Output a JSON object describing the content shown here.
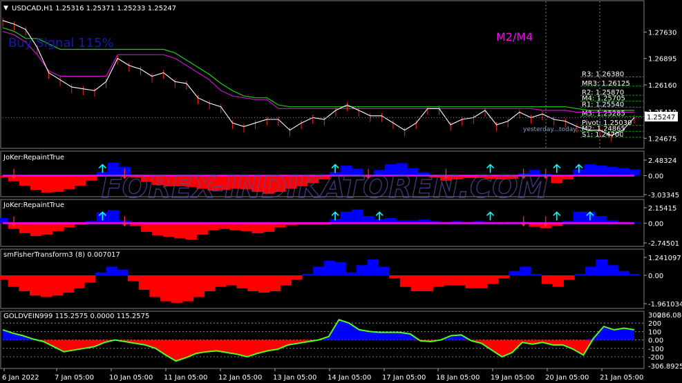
{
  "colors": {
    "background": "#000000",
    "grid": "#4a4a4a",
    "price_line": "#ffffff",
    "wick": "#ff2020",
    "envelope_upper": "#18d018",
    "envelope_lower": "#d010d0",
    "buy_label": "#1a1aaa",
    "m2m4_label": "#ff00ff",
    "histogram_positive": "#0000ff",
    "histogram_negative": "#ff0000",
    "zero_line": "#ff00ff",
    "arrow_up": "#00ffff",
    "arrow_down": "#ff3030",
    "goldvein_line": "#50ff20",
    "pivot_dash": "#00a000",
    "watermark": "#5a4aa0"
  },
  "main_panel": {
    "header": "USDCAD,H1  1.25316 1.25371 1.25233 1.25247",
    "signal_label": "Buy Signal 115%",
    "mode_label": "M2/M4",
    "current_price": "1.25247",
    "yesterday_label": "yesterday...today...",
    "menu_icon": "triangle-down-icon"
  },
  "watermark": "FOREX-INDIKATOREN.COM",
  "chart_data": [
    {
      "type": "line",
      "name": "USDCAD H1 price",
      "ylim": [
        1.2445,
        1.281
      ],
      "y_ticks": [
        "1.27630",
        "1.26895",
        "1.26160",
        "1.25410",
        "1.24675"
      ],
      "x_ticks": [
        "6 Jan 2022",
        "7 Jan 05:00",
        "10 Jan 05:00",
        "11 Jan 05:00",
        "12 Jan 05:00",
        "13 Jan 05:00",
        "14 Jan 05:00",
        "17 Jan 05:00",
        "18 Jan 05:00",
        "19 Jan 05:00",
        "20 Jan 05:00",
        "21 Jan 05:00"
      ],
      "price": [
        1.2795,
        1.2785,
        1.277,
        1.272,
        1.265,
        1.263,
        1.261,
        1.2605,
        1.26,
        1.2625,
        1.269,
        1.267,
        1.266,
        1.264,
        1.265,
        1.2625,
        1.262,
        1.258,
        1.2565,
        1.2555,
        1.251,
        1.25,
        1.251,
        1.252,
        1.252,
        1.249,
        1.251,
        1.2525,
        1.252,
        1.2545,
        1.256,
        1.2545,
        1.253,
        1.253,
        1.251,
        1.249,
        1.251,
        1.255,
        1.255,
        1.2505,
        1.252,
        1.2525,
        1.2545,
        1.2505,
        1.2515,
        1.254,
        1.2525,
        1.2535,
        1.252,
        1.2515,
        1.25,
        1.249,
        1.249,
        1.2475,
        1.249,
        1.2525
      ],
      "envelope_upper": [
        1.2775,
        1.2765,
        1.2745,
        1.2745,
        1.273,
        1.2715,
        1.2715,
        1.2715,
        1.2715,
        1.2715,
        1.2715,
        1.2715,
        1.2715,
        1.2715,
        1.2715,
        1.2705,
        1.2685,
        1.2665,
        1.2645,
        1.262,
        1.26,
        1.2585,
        1.258,
        1.258,
        1.256,
        1.2555,
        1.2555,
        1.2555,
        1.2555,
        1.2555,
        1.2555,
        1.2555,
        1.2555,
        1.2555,
        1.2555,
        1.2555,
        1.2555,
        1.2555,
        1.2555,
        1.2555,
        1.2555,
        1.2555,
        1.2555,
        1.2555,
        1.2555,
        1.2555,
        1.2555,
        1.2555,
        1.2555,
        1.2555,
        1.255,
        1.2545,
        1.2545,
        1.2545,
        1.2545,
        1.2545
      ],
      "envelope_lower": [
        1.2765,
        1.2755,
        1.2735,
        1.27,
        1.2655,
        1.264,
        1.264,
        1.264,
        1.264,
        1.264,
        1.27,
        1.27,
        1.27,
        1.27,
        1.27,
        1.269,
        1.267,
        1.265,
        1.263,
        1.26,
        1.2585,
        1.258,
        1.2575,
        1.2575,
        1.255,
        1.255,
        1.255,
        1.255,
        1.255,
        1.255,
        1.255,
        1.255,
        1.255,
        1.255,
        1.255,
        1.255,
        1.255,
        1.255,
        1.255,
        1.255,
        1.255,
        1.255,
        1.255,
        1.255,
        1.255,
        1.255,
        1.255,
        1.2545,
        1.2545,
        1.2545,
        1.254,
        1.254,
        1.254,
        1.254,
        1.254,
        1.254
      ],
      "pivots": [
        {
          "label": "R3:",
          "value": "1.26380",
          "y": 1.2638
        },
        {
          "label": "MR3:",
          "value": "1.26125",
          "y": 1.26125
        },
        {
          "label": "R2:",
          "value": "1.25870",
          "y": 1.2587
        },
        {
          "label": "M4:",
          "value": "1.25705",
          "y": 1.25705
        },
        {
          "label": "R1:",
          "value": "1.25540",
          "y": 1.2554
        },
        {
          "label": "M3:",
          "value": "1.25285",
          "y": 1.25285
        },
        {
          "label": "Pivot:",
          "value": "1.25030",
          "y": 1.2503
        },
        {
          "label": "M2:",
          "value": "1.24865",
          "y": 1.24865
        },
        {
          "label": "S1:",
          "value": "1.24700",
          "y": 1.247
        }
      ]
    },
    {
      "type": "bar",
      "name": "JoKer:RepaintTrue",
      "title": "JoKer:RepaintTrue",
      "ylim": [
        -3.03345,
        2.48324
      ],
      "y_ticks": [
        "2.48324",
        "0.00",
        "-3.03345"
      ],
      "values": [
        -0.3,
        -0.9,
        -1.6,
        -2.3,
        -2.7,
        -2.6,
        -2.2,
        -1.6,
        -0.8,
        0.6,
        2.1,
        1.4,
        -0.3,
        -1.0,
        -1.5,
        -1.7,
        -1.7,
        -1.8,
        -2.1,
        -2.4,
        -2.3,
        -2.1,
        -2.2,
        -2.6,
        -2.9,
        -2.6,
        -2.1,
        -1.7,
        -1.2,
        -0.6,
        0.6,
        1.6,
        1.1,
        -0.2,
        0.9,
        1.8,
        2.0,
        1.2,
        0.5,
        -0.3,
        -0.8,
        -0.6,
        -0.4,
        -0.4,
        -0.5,
        -0.6,
        -0.5,
        0.4,
        0.9,
        0.3,
        -1.2,
        -0.6,
        1.0,
        1.8,
        1.6,
        1.4,
        1.2,
        1.0
      ],
      "up_arrows": [
        9,
        30,
        44,
        50,
        52
      ],
      "down_arrows": [
        1,
        11,
        33,
        40,
        47,
        49
      ]
    },
    {
      "type": "bar",
      "name": "JoKer:RepaintTrue",
      "title": "JoKer:RepaintTrue",
      "ylim": [
        -2.74501,
        2.15415
      ],
      "y_ticks": [
        "2.15415",
        "0.00",
        "-2.74501"
      ],
      "values": [
        0.7,
        -0.8,
        -1.4,
        -1.8,
        -1.6,
        -1.1,
        -0.6,
        -0.2,
        0.3,
        1.5,
        1.8,
        0.4,
        -0.4,
        -1.2,
        -1.7,
        -1.9,
        -2.1,
        -2.3,
        -1.6,
        -1.0,
        -0.8,
        -1.0,
        -1.1,
        -1.4,
        -1.2,
        -0.6,
        -0.3,
        -0.2,
        -0.2,
        -0.2,
        0.6,
        1.6,
        1.9,
        1.0,
        0.6,
        0.7,
        0.4,
        0.4,
        0.5,
        0.3,
        0.2,
        0.3,
        0.2,
        0.3,
        0.2,
        0.1,
        0.2,
        0.2,
        -0.5,
        -0.7,
        -0.4,
        0.3,
        1.6,
        1.6,
        1.0,
        0.4,
        0.2,
        0.1
      ],
      "up_arrows": [
        9,
        30,
        34,
        44,
        50,
        53
      ],
      "down_arrows": [
        1,
        11,
        47,
        49
      ]
    },
    {
      "type": "bar",
      "name": "smFisherTransform3 (8)",
      "title": "smFisherTransform3 (8) 0.007017",
      "ylim": [
        -1.961034,
        1.241097
      ],
      "y_ticks": [
        "1.241097",
        "0.00",
        "-1.961034"
      ],
      "values": [
        -0.3,
        -0.8,
        -1.1,
        -1.4,
        -1.5,
        -1.4,
        -1.2,
        -0.9,
        -0.5,
        0.2,
        0.6,
        0.4,
        -0.4,
        -1.0,
        -1.5,
        -1.8,
        -1.9,
        -1.8,
        -1.5,
        -1.1,
        -0.8,
        -0.7,
        -0.9,
        -1.1,
        -1.2,
        -1.1,
        -0.7,
        -0.3,
        0.1,
        0.6,
        1.0,
        0.9,
        0.2,
        0.7,
        1.1,
        0.6,
        -0.2,
        -0.8,
        -1.1,
        -1.1,
        -0.8,
        -0.7,
        -0.7,
        -0.9,
        -0.9,
        -0.6,
        -0.2,
        0.3,
        0.6,
        0.1,
        -0.6,
        -0.8,
        -0.3,
        0.1,
        0.6,
        1.1,
        0.7,
        0.3,
        0.1
      ],
      "up_arrows": [],
      "down_arrows": []
    },
    {
      "type": "line",
      "name": "GOLDVEIN999",
      "title": "GOLDVEIN999 115.2575 0.0000 115.2575",
      "ylim": [
        -306.8925,
        300
      ],
      "y_ticks": [
        "300",
        "200",
        "100",
        "0.00",
        "-100",
        "-200",
        "-306.8925"
      ],
      "extra_ticks": [
        "286.0863",
        "300"
      ],
      "values": [
        120,
        80,
        50,
        10,
        -20,
        -80,
        -140,
        -120,
        -100,
        -80,
        -30,
        0,
        -20,
        -40,
        -60,
        -100,
        -180,
        -250,
        -210,
        -160,
        -140,
        -130,
        -150,
        -170,
        -200,
        -160,
        -130,
        -110,
        -60,
        -40,
        -20,
        0,
        40,
        240,
        200,
        120,
        100,
        90,
        90,
        90,
        70,
        -10,
        -20,
        0,
        50,
        60,
        -10,
        -40,
        -120,
        -200,
        -150,
        -30,
        -50,
        -30,
        -60,
        -60,
        -110,
        -180,
        20,
        160,
        120,
        140,
        120
      ]
    }
  ]
}
